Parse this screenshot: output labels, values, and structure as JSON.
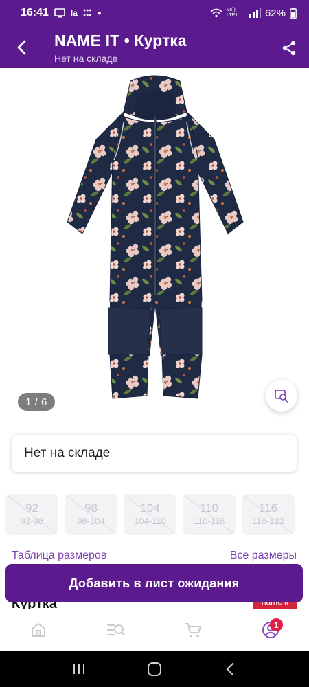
{
  "status_bar": {
    "time": "16:41",
    "battery": "62%",
    "network": "Vo)) LTE1"
  },
  "header": {
    "title": "NAME IT • Куртка",
    "subtitle": "Нет на складе",
    "back_icon": "arrow-back-icon",
    "share_icon": "share-icon"
  },
  "gallery": {
    "counter": "1 / 6"
  },
  "stock": {
    "label": "Нет на складе"
  },
  "sizes": [
    {
      "size": "92",
      "range": "92-98"
    },
    {
      "size": "98",
      "range": "98-104"
    },
    {
      "size": "104",
      "range": "104-110"
    },
    {
      "size": "110",
      "range": "110-116"
    },
    {
      "size": "116",
      "range": "116-122"
    }
  ],
  "size_links": {
    "table": "Таблица размеров",
    "all": "Все размеры"
  },
  "product": {
    "peek_title": "Куртка",
    "peek_brand": "name it"
  },
  "cta": {
    "label": "Добавить в лист ожидания"
  },
  "bottom_nav": {
    "profile_badge": "1"
  },
  "colors": {
    "brand": "#5b1a8e",
    "link": "#7c3fb3",
    "badge": "#e11d48"
  }
}
